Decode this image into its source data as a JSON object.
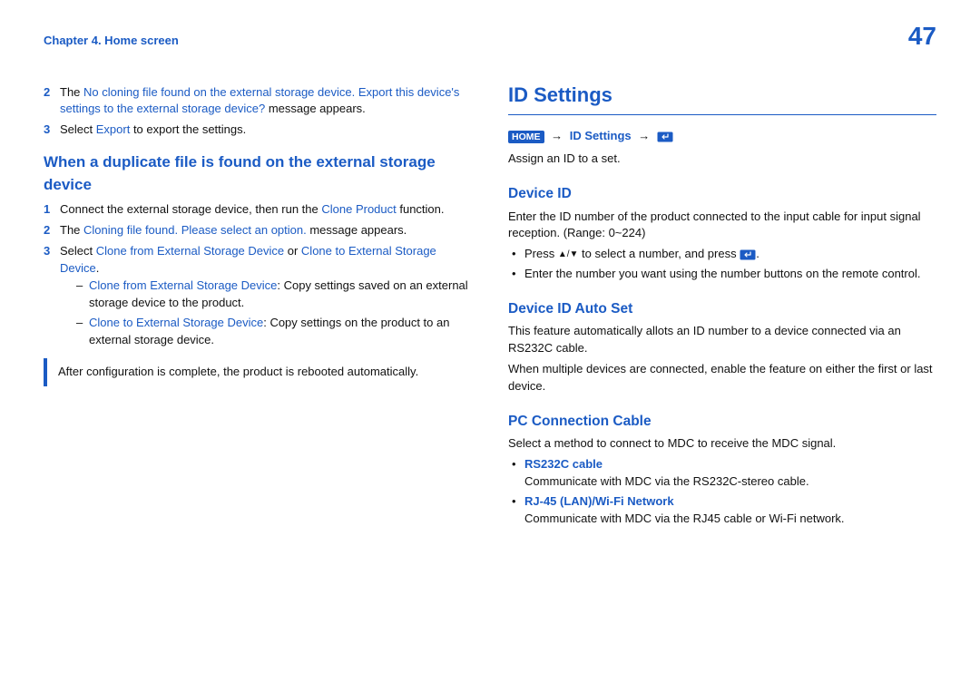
{
  "page": {
    "chapter_ref": "Chapter 4. Home screen",
    "page_number": "47"
  },
  "left": {
    "step2_a": "The ",
    "step2_blue": "No cloning file found on the external storage device. Export this device's settings to the external storage device?",
    "step2_b": " message appears.",
    "step3_a": "Select ",
    "step3_blue": "Export",
    "step3_b": " to export the settings.",
    "h2": "When a duplicate file is found on the external storage device",
    "d1_a": "Connect the external storage device, then run the ",
    "d1_blue": "Clone Product",
    "d1_b": " function.",
    "d2_a": "The ",
    "d2_blue": "Cloning file found. Please select an option.",
    "d2_b": " message appears.",
    "d3_a": "Select ",
    "d3_blue1": "Clone from External Storage Device",
    "d3_mid": " or ",
    "d3_blue2": "Clone to External Storage Device",
    "d3_b": ".",
    "dash1_label": "Clone from External Storage Device",
    "dash1_text": ": Copy settings saved on an external storage device to the product.",
    "dash2_label": "Clone to External Storage Device",
    "dash2_text": ": Copy settings on the product to an external storage device.",
    "note": "After configuration is complete, the product is rebooted automatically."
  },
  "right": {
    "h1": "ID Settings",
    "crumb_home": "HOME",
    "crumb_text": "ID Settings",
    "assign": "Assign an ID to a set.",
    "devid_h": "Device ID",
    "devid_p": "Enter the ID number of the product connected to the input cable for input signal reception. (Range: 0~224)",
    "devid_b1a": "Press ",
    "devid_b1b": " to select a number, and press ",
    "devid_b1c": ".",
    "devid_b2": "Enter the number you want using the number buttons on the remote control.",
    "auto_h": "Device ID Auto Set",
    "auto_p1": "This feature automatically allots an ID number to a device connected via an RS232C cable.",
    "auto_p2": "When multiple devices are connected, enable the feature on either the first or last device.",
    "pc_h": "PC Connection Cable",
    "pc_p": "Select a method to connect to MDC to receive the MDC signal.",
    "pc_b1_label": "RS232C cable",
    "pc_b1_text": "Communicate with MDC via the RS232C-stereo cable.",
    "pc_b2_label": "RJ-45 (LAN)/Wi-Fi Network",
    "pc_b2_text": "Communicate with MDC via the RJ45 cable or Wi-Fi network."
  }
}
